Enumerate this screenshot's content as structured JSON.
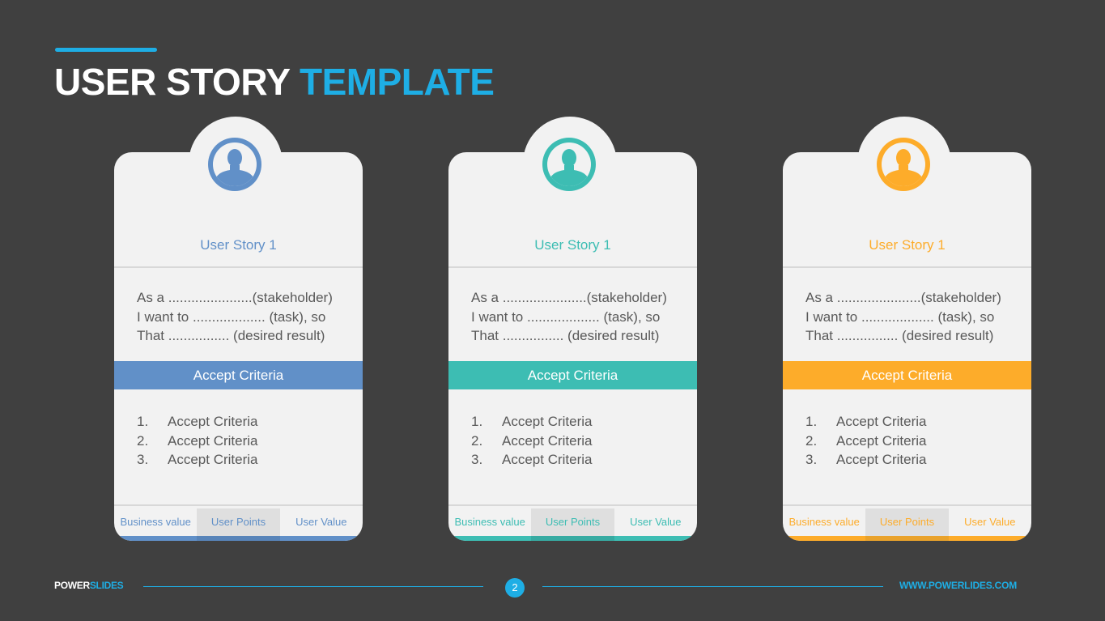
{
  "header": {
    "title_main": "USER STORY",
    "title_accent": "TEMPLATE",
    "accent_color": "#1eaee5"
  },
  "cards": [
    {
      "icon": "user-silhouette-icon",
      "color": "#6190c8",
      "dark": "#5884b9",
      "story_title": "User Story 1",
      "lines": [
        "As a ......................(stakeholder)",
        "I want to ................... (task), so",
        "That ................ (desired result)"
      ],
      "accept_label": "Accept Criteria",
      "criteria": [
        {
          "num": "1.",
          "text": "Accept Criteria"
        },
        {
          "num": "2.",
          "text": "Accept Criteria"
        },
        {
          "num": "3.",
          "text": "Accept Criteria"
        }
      ],
      "footer_labels": [
        "Business value",
        "User Points",
        "User Value"
      ]
    },
    {
      "icon": "user-silhouette-icon",
      "color": "#3dbdb3",
      "dark": "#37aba2",
      "story_title": "User Story 1",
      "lines": [
        "As a ......................(stakeholder)",
        "I want to ................... (task), so",
        "That ................ (desired result)"
      ],
      "accept_label": "Accept Criteria",
      "criteria": [
        {
          "num": "1.",
          "text": "Accept Criteria"
        },
        {
          "num": "2.",
          "text": "Accept Criteria"
        },
        {
          "num": "3.",
          "text": "Accept Criteria"
        }
      ],
      "footer_labels": [
        "Business value",
        "User Points",
        "User Value"
      ]
    },
    {
      "icon": "user-silhouette-icon",
      "color": "#fdac2a",
      "dark": "#e9a22b",
      "story_title": "User Story 1",
      "lines": [
        "As a ......................(stakeholder)",
        "I want to ................... (task), so",
        "That ................ (desired result)"
      ],
      "accept_label": "Accept Criteria",
      "criteria": [
        {
          "num": "1.",
          "text": "Accept Criteria"
        },
        {
          "num": "2.",
          "text": "Accept Criteria"
        },
        {
          "num": "3.",
          "text": "Accept Criteria"
        }
      ],
      "footer_labels": [
        "Business value",
        "User Points",
        "User Value"
      ]
    }
  ],
  "footer": {
    "brand_main": "POWER",
    "brand_accent": "SLIDES",
    "page_number": "2",
    "url": "WWW.POWERLIDES.COM"
  }
}
